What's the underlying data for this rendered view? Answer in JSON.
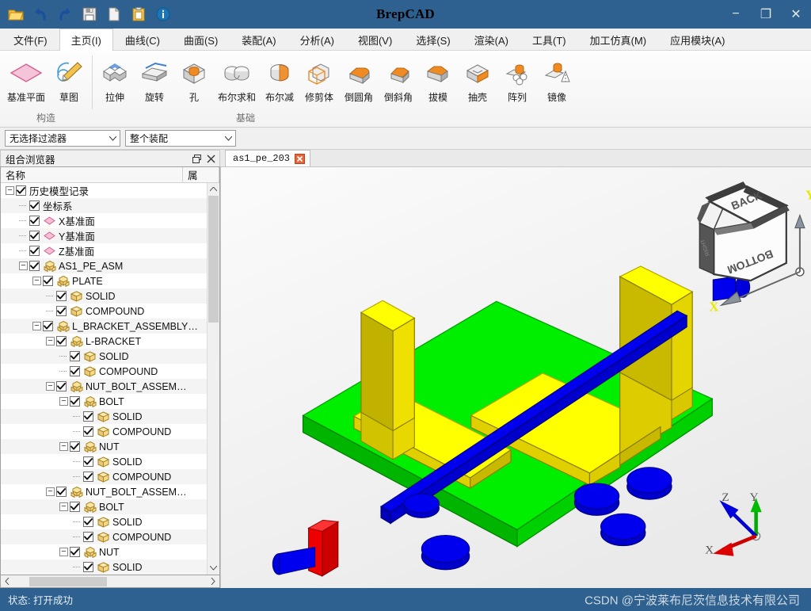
{
  "window": {
    "title": "BrepCAD",
    "minimize_label": "−",
    "restore_label": "❐",
    "close_label": "✕"
  },
  "quick_access": [
    {
      "name": "open-icon",
      "tooltip": "打开"
    },
    {
      "name": "undo-icon",
      "tooltip": "撤销"
    },
    {
      "name": "redo-icon",
      "tooltip": "重做"
    },
    {
      "name": "save-icon",
      "tooltip": "保存"
    },
    {
      "name": "copy-icon",
      "tooltip": "复制"
    },
    {
      "name": "paste-icon",
      "tooltip": "粘贴"
    },
    {
      "name": "info-icon",
      "tooltip": "信息"
    }
  ],
  "ribbon_tabs": [
    {
      "label": "文件(F)",
      "active": false
    },
    {
      "label": "主页(I)",
      "active": true
    },
    {
      "label": "曲线(C)",
      "active": false
    },
    {
      "label": "曲面(S)",
      "active": false
    },
    {
      "label": "装配(A)",
      "active": false
    },
    {
      "label": "分析(A)",
      "active": false
    },
    {
      "label": "视图(V)",
      "active": false
    },
    {
      "label": "选择(S)",
      "active": false
    },
    {
      "label": "渲染(A)",
      "active": false
    },
    {
      "label": "工具(T)",
      "active": false
    },
    {
      "label": "加工仿真(M)",
      "active": false
    },
    {
      "label": "应用模块(A)",
      "active": false
    }
  ],
  "ribbon_groups": [
    {
      "label": "构造",
      "buttons": [
        {
          "label": "基准平面",
          "icon": "datum-plane-icon"
        },
        {
          "label": "草图",
          "icon": "sketch-icon"
        }
      ]
    },
    {
      "label": "基础",
      "buttons": [
        {
          "label": "拉伸",
          "icon": "extrude-icon"
        },
        {
          "label": "旋转",
          "icon": "revolve-icon"
        },
        {
          "label": "孔",
          "icon": "hole-icon"
        },
        {
          "label": "布尔求和",
          "icon": "boolean-union-icon"
        },
        {
          "label": "布尔减",
          "icon": "boolean-subtract-icon"
        },
        {
          "label": "修剪体",
          "icon": "trim-body-icon"
        },
        {
          "label": "倒圆角",
          "icon": "fillet-icon"
        },
        {
          "label": "倒斜角",
          "icon": "chamfer-icon"
        },
        {
          "label": "拔模",
          "icon": "draft-icon"
        },
        {
          "label": "抽壳",
          "icon": "shell-icon"
        },
        {
          "label": "阵列",
          "icon": "pattern-icon"
        },
        {
          "label": "镜像",
          "icon": "mirror-icon"
        }
      ]
    }
  ],
  "filter_bar": {
    "selection_filter": {
      "value": "无选择过滤器"
    },
    "scope_filter": {
      "value": "整个装配"
    }
  },
  "dock": {
    "title": "组合浏览器",
    "float_label": "❐",
    "close_label": "✕"
  },
  "tree": {
    "columns": [
      "名称",
      "属"
    ],
    "rows": [
      {
        "label": "历史模型记录",
        "depth": 0,
        "icon": "none",
        "expander": true,
        "checked": true
      },
      {
        "label": "坐标系",
        "depth": 1,
        "icon": "none",
        "expander": false,
        "checked": true
      },
      {
        "label": "X基准面",
        "depth": 1,
        "icon": "plane",
        "expander": false,
        "checked": true
      },
      {
        "label": "Y基准面",
        "depth": 1,
        "icon": "plane",
        "expander": false,
        "checked": true
      },
      {
        "label": "Z基准面",
        "depth": 1,
        "icon": "plane",
        "expander": false,
        "checked": true
      },
      {
        "label": "AS1_PE_ASM",
        "depth": 1,
        "icon": "assembly",
        "expander": true,
        "checked": true
      },
      {
        "label": "PLATE",
        "depth": 2,
        "icon": "assembly",
        "expander": true,
        "checked": true
      },
      {
        "label": "SOLID",
        "depth": 3,
        "icon": "solid",
        "expander": false,
        "checked": true
      },
      {
        "label": "COMPOUND",
        "depth": 3,
        "icon": "solid",
        "expander": false,
        "checked": true
      },
      {
        "label": "L_BRACKET_ASSEMBLY…",
        "depth": 2,
        "icon": "assembly",
        "expander": true,
        "checked": true
      },
      {
        "label": "L-BRACKET",
        "depth": 3,
        "icon": "assembly",
        "expander": true,
        "checked": true
      },
      {
        "label": "SOLID",
        "depth": 4,
        "icon": "solid",
        "expander": false,
        "checked": true
      },
      {
        "label": "COMPOUND",
        "depth": 4,
        "icon": "solid",
        "expander": false,
        "checked": true
      },
      {
        "label": "NUT_BOLT_ASSEM…",
        "depth": 3,
        "icon": "assembly",
        "expander": true,
        "checked": true
      },
      {
        "label": "BOLT",
        "depth": 4,
        "icon": "assembly",
        "expander": true,
        "checked": true
      },
      {
        "label": "SOLID",
        "depth": 5,
        "icon": "solid",
        "expander": false,
        "checked": true
      },
      {
        "label": "COMPOUND",
        "depth": 5,
        "icon": "solid",
        "expander": false,
        "checked": true
      },
      {
        "label": "NUT",
        "depth": 4,
        "icon": "assembly",
        "expander": true,
        "checked": true
      },
      {
        "label": "SOLID",
        "depth": 5,
        "icon": "solid",
        "expander": false,
        "checked": true
      },
      {
        "label": "COMPOUND",
        "depth": 5,
        "icon": "solid",
        "expander": false,
        "checked": true
      },
      {
        "label": "NUT_BOLT_ASSEM…",
        "depth": 3,
        "icon": "assembly",
        "expander": true,
        "checked": true
      },
      {
        "label": "BOLT",
        "depth": 4,
        "icon": "assembly",
        "expander": true,
        "checked": true
      },
      {
        "label": "SOLID",
        "depth": 5,
        "icon": "solid",
        "expander": false,
        "checked": true
      },
      {
        "label": "COMPOUND",
        "depth": 5,
        "icon": "solid",
        "expander": false,
        "checked": true
      },
      {
        "label": "NUT",
        "depth": 4,
        "icon": "assembly",
        "expander": true,
        "checked": true
      },
      {
        "label": "SOLID",
        "depth": 5,
        "icon": "solid",
        "expander": false,
        "checked": true
      }
    ]
  },
  "document": {
    "tabs": [
      {
        "label": "as1_pe_203",
        "active": true,
        "close_label": "✕"
      }
    ]
  },
  "viewport": {
    "view_cube": {
      "faces": [
        "BACK",
        "BOTTOM",
        "RIGHT"
      ],
      "axis_x_label": "X",
      "axis_y_label": "Y",
      "axis_color": "#e8e800"
    },
    "axis_triad": {
      "x_label": "X",
      "y_label": "Y",
      "z_label": "Z",
      "x_color": "#dd0000",
      "y_color": "#00bb00",
      "z_color": "#0000dd"
    },
    "model_colors": {
      "plate": "#00ee00",
      "bracket": "#ffff00",
      "bolt": "#0000ee",
      "marker": "#ee0000"
    }
  },
  "status": {
    "text": "状态: 打开成功",
    "watermark": "CSDN @宁波莱布尼茨信息技术有限公司"
  },
  "theme": {
    "titlebar": "#2e6190",
    "ribbon_bg": "#f5f5f5",
    "accent_orange": "#ef8b22"
  }
}
